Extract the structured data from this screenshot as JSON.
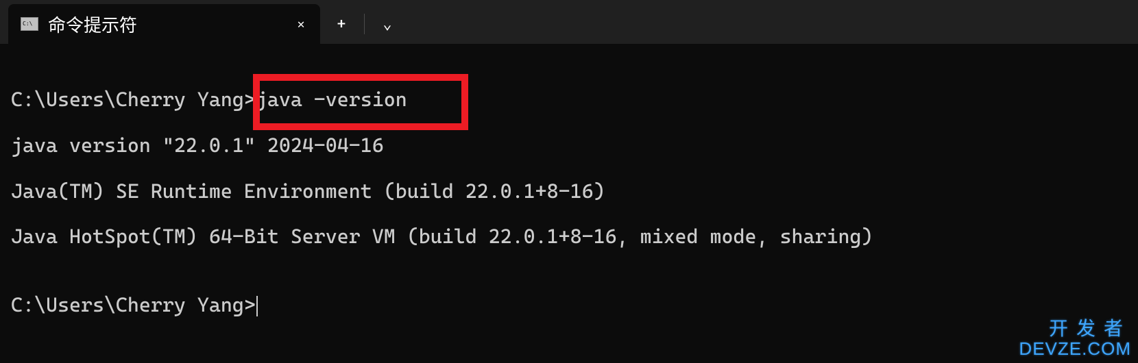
{
  "tab": {
    "title": "命令提示符",
    "icon_text": "C:\\"
  },
  "terminal": {
    "lines": [
      "C:\\Users\\Cherry Yang>java -version",
      "java version \"22.0.1\" 2024-04-16",
      "Java(TM) SE Runtime Environment (build 22.0.1+8-16)",
      "Java HotSpot(TM) 64-Bit Server VM (build 22.0.1+8-16, mixed mode, sharing)",
      "",
      "C:\\Users\\Cherry Yang>"
    ],
    "prompt_path": "C:\\Users\\Cherry Yang>",
    "command": "java -version",
    "java_version": "22.0.1",
    "java_date": "2024-04-16",
    "java_build": "22.0.1+8-16"
  },
  "highlight": {
    "text": "java -version"
  },
  "watermark": {
    "cn": "开发者",
    "en": "DEVZE.COM"
  },
  "icons": {
    "close": "✕",
    "plus": "+",
    "chevron_down": "⌄"
  }
}
